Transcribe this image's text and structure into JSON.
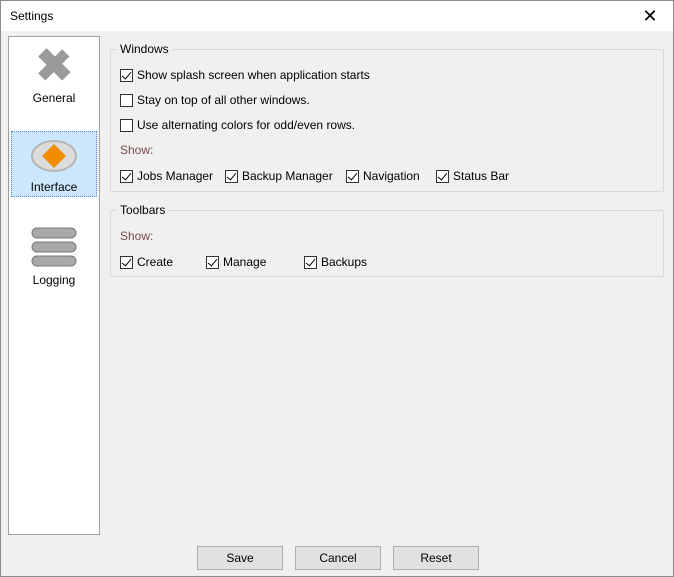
{
  "window": {
    "title": "Settings"
  },
  "sidebar": {
    "items": [
      {
        "label": "General"
      },
      {
        "label": "Interface"
      },
      {
        "label": "Logging"
      }
    ]
  },
  "windows_group": {
    "title": "Windows",
    "options": [
      {
        "label": "Show splash screen when application starts",
        "checked": true
      },
      {
        "label": "Stay on top of all other windows.",
        "checked": false
      },
      {
        "label": "Use alternating colors for odd/even rows.",
        "checked": false
      }
    ],
    "show_label": "Show:",
    "show_items": [
      {
        "label": "Jobs Manager",
        "checked": true
      },
      {
        "label": "Backup Manager",
        "checked": true
      },
      {
        "label": "Navigation",
        "checked": true
      },
      {
        "label": "Status Bar",
        "checked": true
      }
    ]
  },
  "toolbars_group": {
    "title": "Toolbars",
    "show_label": "Show:",
    "show_items": [
      {
        "label": "Create",
        "checked": true
      },
      {
        "label": "Manage",
        "checked": true
      },
      {
        "label": "Backups",
        "checked": true
      }
    ]
  },
  "buttons": {
    "save": "Save",
    "cancel": "Cancel",
    "reset": "Reset"
  },
  "colors": {
    "selection_bg": "#cce8ff",
    "accent_orange": "#f28c00",
    "show_label": "#7a4a4a"
  }
}
